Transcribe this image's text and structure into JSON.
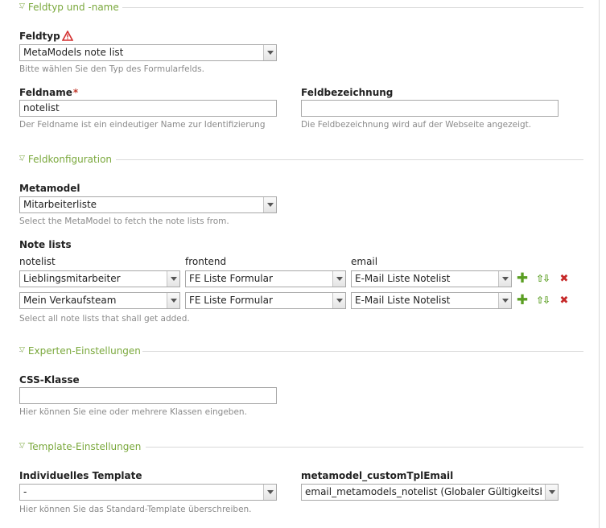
{
  "sections": {
    "feldtyp_name": "Feldtyp und -name",
    "feldkonfiguration": "Feldkonfiguration",
    "experten": "Experten-Einstellungen",
    "template": "Template-Einstellungen"
  },
  "feldtyp": {
    "label": "Feldtyp",
    "value": "MetaModels note list",
    "help": "Bitte wählen Sie den Typ des Formularfelds."
  },
  "feldname": {
    "label": "Feldname",
    "required_mark": "*",
    "value": "notelist",
    "help": "Der Feldname ist ein eindeutiger Name zur Identifizierung"
  },
  "feldbezeichnung": {
    "label": "Feldbezeichnung",
    "value": "",
    "help": "Die Feldbezeichnung wird auf der Webseite angezeigt."
  },
  "metamodel": {
    "label": "Metamodel",
    "value": "Mitarbeiterliste",
    "help": "Select the MetaModel to fetch the note lists from."
  },
  "notelists": {
    "label": "Note lists",
    "columns": [
      "notelist",
      "frontend",
      "email"
    ],
    "rows": [
      {
        "notelist": "Lieblingsmitarbeiter",
        "frontend": "FE Liste Formular",
        "email": "E-Mail Liste Notelist"
      },
      {
        "notelist": "Mein Verkaufsteam",
        "frontend": "FE Liste Formular",
        "email": "E-Mail Liste Notelist"
      }
    ],
    "help": "Select all note lists that shall get added."
  },
  "css_klasse": {
    "label": "CSS-Klasse",
    "value": "",
    "help": "Hier können Sie eine oder mehrere Klassen eingeben."
  },
  "template": {
    "label": "Individuelles Template",
    "value": "-",
    "help": "Hier können Sie das Standard-Template überschreiben."
  },
  "tpl_email": {
    "label": "metamodel_customTplEmail",
    "value": "email_metamodels_notelist (Globaler Gültigkeitsbereich)"
  },
  "colors": {
    "legend": "#7aa83c",
    "add": "#5a9e22",
    "delete": "#c62828",
    "warning": "#d32f2f"
  },
  "icons": {
    "warning": "warning-icon",
    "add": "add-icon",
    "move": "move-up-down-icon",
    "delete": "delete-icon"
  }
}
